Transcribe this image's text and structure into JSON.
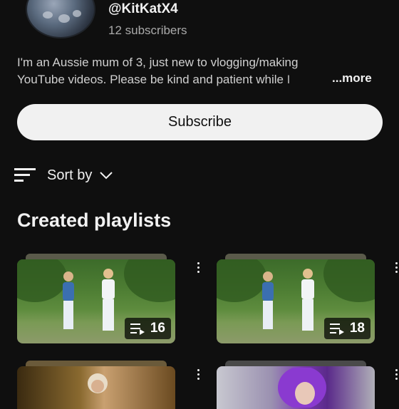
{
  "channel": {
    "handle": "@KitKatX4",
    "subscribers": "12 subscribers",
    "description_line1": "I'm an Aussie mum of 3, just new to vlogging/making",
    "description_line2": "YouTube videos. Please be kind and patient while I",
    "more_label": "...more"
  },
  "actions": {
    "subscribe_label": "Subscribe",
    "sort_label": "Sort by"
  },
  "section": {
    "title": "Created playlists"
  },
  "playlists": [
    {
      "count": "16"
    },
    {
      "count": "18"
    }
  ],
  "icons": {
    "sort": "sort-icon",
    "chevron": "chevron-down-icon",
    "playlist": "playlist-icon",
    "more": "more-vert-icon"
  },
  "colors": {
    "background": "#0f0f0f",
    "subscribe_bg": "#f1f1f1",
    "secondary_text": "#aaaaaa"
  }
}
